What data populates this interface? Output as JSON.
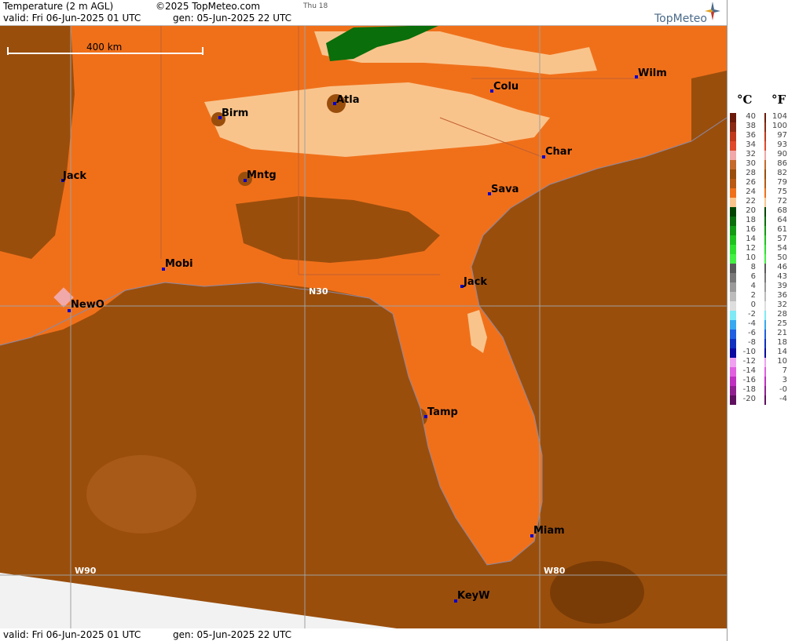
{
  "header": {
    "title": "Temperature (2 m AGL)",
    "copyright": "©2025 TopMeteo.com",
    "day_label": "Thu 18",
    "valid": "valid:  Fri  06-Jun-2025  01 UTC",
    "generated": "gen: 05-Jun-2025 22 UTC",
    "brand": "TopMeteo"
  },
  "footer": {
    "valid": "valid:  Fri  06-Jun-2025  01 UTC",
    "generated": "gen: 05-Jun-2025 22 UTC"
  },
  "scale_bar": {
    "label": "400 km"
  },
  "grid_labels": {
    "lat": "N30",
    "lon_west": "W90",
    "lon_east": "W80"
  },
  "cities": [
    {
      "name": "Jack"
    },
    {
      "name": "Birm"
    },
    {
      "name": "Atla"
    },
    {
      "name": "Colu"
    },
    {
      "name": "Wilm"
    },
    {
      "name": "Mntg"
    },
    {
      "name": "Char"
    },
    {
      "name": "Sava"
    },
    {
      "name": "Mobi"
    },
    {
      "name": "Jack"
    },
    {
      "name": "NewO"
    },
    {
      "name": "Tamp"
    },
    {
      "name": "Miam"
    },
    {
      "name": "KeyW"
    }
  ],
  "legend": {
    "unit_c": "°C",
    "unit_f": "°F",
    "celsius": [
      "40",
      "38",
      "36",
      "34",
      "32",
      "30",
      "28",
      "26",
      "24",
      "22",
      "20",
      "18",
      "16",
      "14",
      "12",
      "10",
      "8",
      "6",
      "4",
      "2",
      "0",
      "-2",
      "-4",
      "-6",
      "-8",
      "-10",
      "-12",
      "-14",
      "-16",
      "-18",
      "-20"
    ],
    "fahrenheit": [
      "104",
      "100",
      "97",
      "93",
      "90",
      "86",
      "82",
      "79",
      "75",
      "72",
      "68",
      "64",
      "61",
      "57",
      "54",
      "50",
      "46",
      "43",
      "39",
      "36",
      "32",
      "28",
      "25",
      "21",
      "18",
      "14",
      "10",
      "7",
      "3",
      "-0",
      "-4"
    ],
    "colors": [
      "#6b1a0a",
      "#8b2a12",
      "#c0391b",
      "#e04a2a",
      "#f0a8a8",
      "#c46a2a",
      "#9a4e0c",
      "#b85a12",
      "#f0701a",
      "#f9c48c",
      "#004400",
      "#0a6e0a",
      "#129a12",
      "#1ec21e",
      "#2ee02e",
      "#44f044",
      "#5a5a5a",
      "#787878",
      "#9a9a9a",
      "#bcbcbc",
      "#dedede",
      "#7feaf5",
      "#38a8f0",
      "#2060e0",
      "#1030c0",
      "#0a0aa0",
      "#f0a0f0",
      "#e060e0",
      "#c030c0",
      "#902090",
      "#601060"
    ]
  }
}
